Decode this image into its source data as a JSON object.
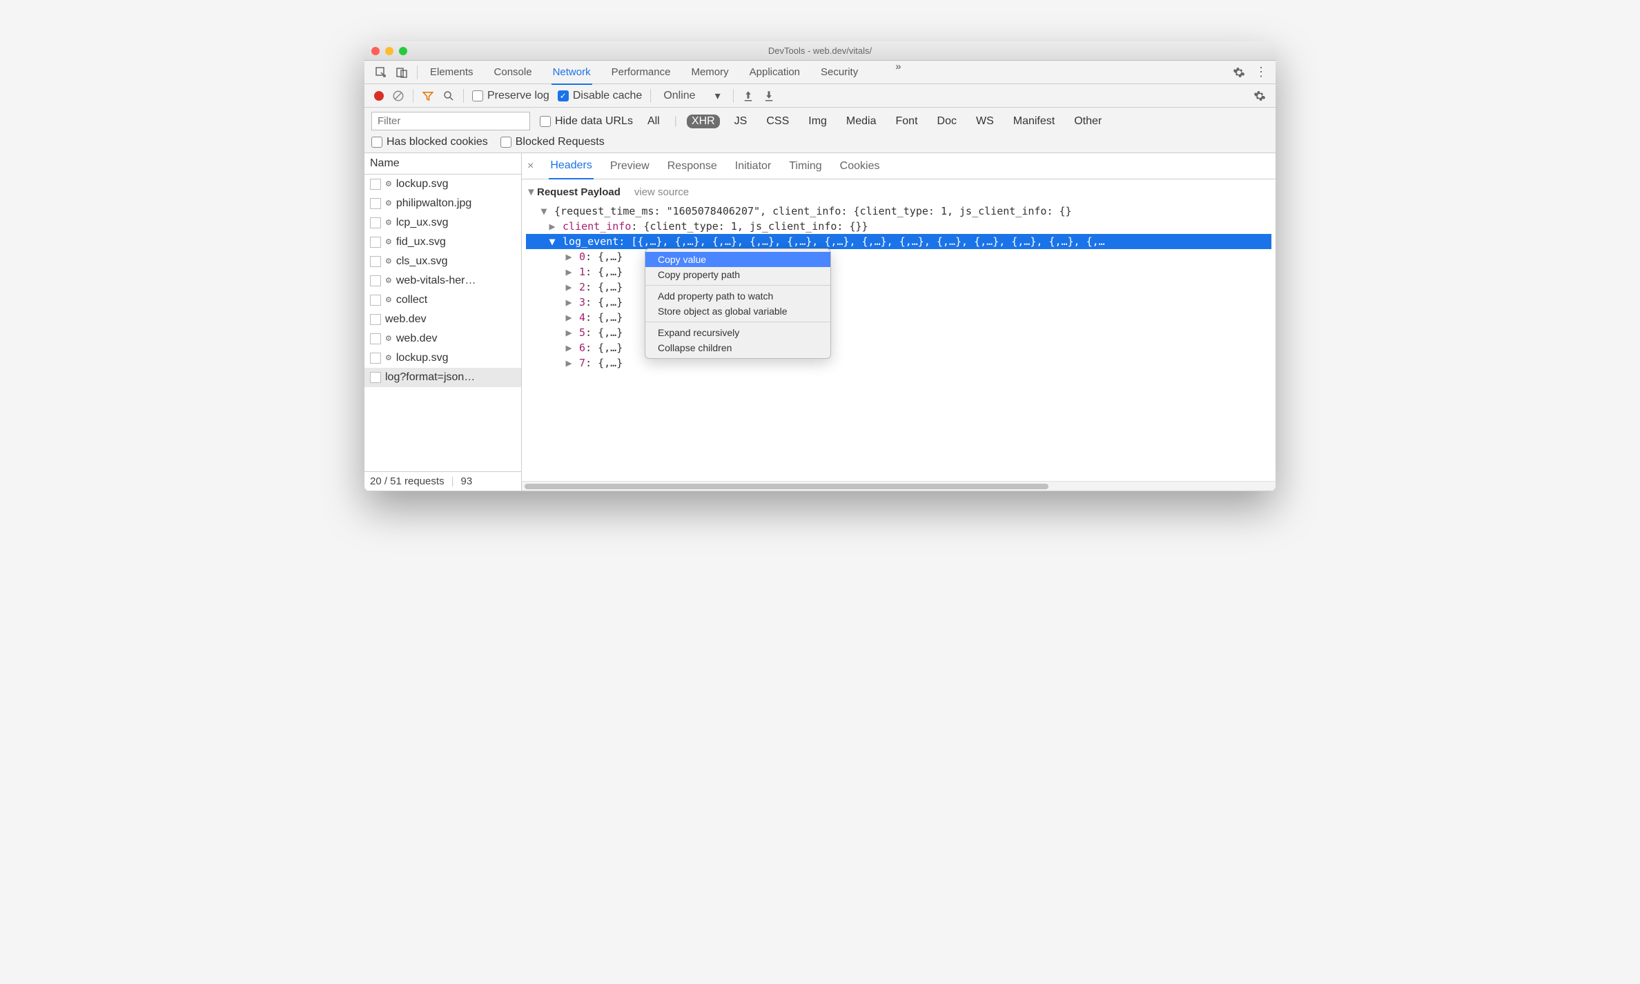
{
  "window_title": "DevTools - web.dev/vitals/",
  "main_tabs": {
    "elements": "Elements",
    "console": "Console",
    "network": "Network",
    "performance": "Performance",
    "memory": "Memory",
    "application": "Application",
    "security": "Security",
    "more": "»"
  },
  "active_main_tab": "Network",
  "net_toolbar": {
    "preserve_log": "Preserve log",
    "disable_cache": "Disable cache",
    "disable_cache_checked": true,
    "throttling": "Online"
  },
  "filter": {
    "placeholder": "Filter",
    "hide_data_urls": "Hide data URLs",
    "types": [
      "All",
      "XHR",
      "JS",
      "CSS",
      "Img",
      "Media",
      "Font",
      "Doc",
      "WS",
      "Manifest",
      "Other"
    ],
    "active_type": "XHR",
    "has_blocked": "Has blocked cookies",
    "blocked_req": "Blocked Requests"
  },
  "sidebar": {
    "header": "Name",
    "files": [
      {
        "gear": true,
        "name": "lockup.svg"
      },
      {
        "gear": true,
        "name": "philipwalton.jpg"
      },
      {
        "gear": true,
        "name": "lcp_ux.svg"
      },
      {
        "gear": true,
        "name": "fid_ux.svg"
      },
      {
        "gear": true,
        "name": "cls_ux.svg"
      },
      {
        "gear": true,
        "name": "web-vitals-her…"
      },
      {
        "gear": true,
        "name": "collect"
      },
      {
        "gear": false,
        "name": "web.dev"
      },
      {
        "gear": true,
        "name": "web.dev"
      },
      {
        "gear": true,
        "name": "lockup.svg"
      },
      {
        "gear": false,
        "name": "log?format=json…",
        "selected": true
      }
    ],
    "status_left": "20 / 51 requests",
    "status_right": "93"
  },
  "detail_tabs": {
    "headers": "Headers",
    "preview": "Preview",
    "response": "Response",
    "initiator": "Initiator",
    "timing": "Timing",
    "cookies": "Cookies"
  },
  "payload": {
    "section_title": "Request Payload",
    "view_source": "view source",
    "root": "{request_time_ms: \"1605078406207\", client_info: {client_type: 1, js_client_info: {}",
    "client_info_key": "client_info",
    "client_info_val": ": {client_type: 1, js_client_info: {}}",
    "log_event_key": "log_event",
    "log_event_val": ": [{,…}, {,…}, {,…}, {,…}, {,…}, {,…}, {,…}, {,…}, {,…}, {,…}, {,…}, {,…}, {,…",
    "items_key": [
      "0",
      "1",
      "2",
      "3",
      "4",
      "5",
      "6",
      "7"
    ],
    "items_val": ": {,…}"
  },
  "context_menu": {
    "copy_value": "Copy value",
    "copy_path": "Copy property path",
    "add_watch": "Add property path to watch",
    "store_global": "Store object as global variable",
    "expand": "Expand recursively",
    "collapse": "Collapse children"
  }
}
